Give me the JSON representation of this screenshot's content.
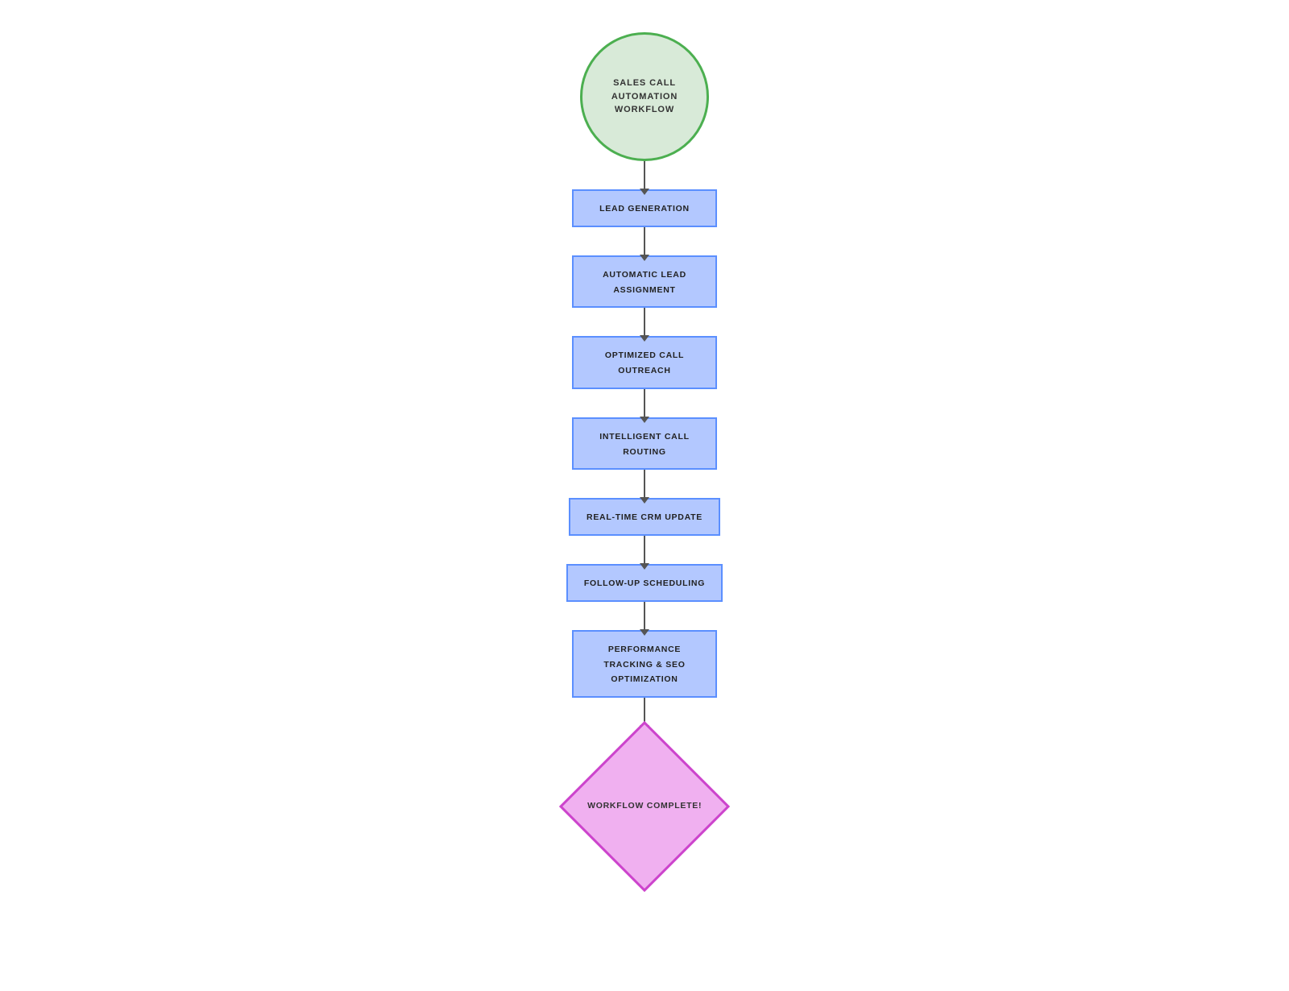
{
  "flowchart": {
    "title": "SALES CALL\nAUTOMATION WORKFLOW",
    "steps": [
      {
        "id": "lead-generation",
        "label": "LEAD GENERATION"
      },
      {
        "id": "automatic-lead-assignment",
        "label": "AUTOMATIC LEAD\nASSIGNMENT"
      },
      {
        "id": "optimized-call-outreach",
        "label": "OPTIMIZED CALL\nOUTREACH"
      },
      {
        "id": "intelligent-call-routing",
        "label": "INTELLIGENT CALL\nROUTING"
      },
      {
        "id": "real-time-crm-update",
        "label": "REAL-TIME CRM UPDATE"
      },
      {
        "id": "follow-up-scheduling",
        "label": "FOLLOW-UP SCHEDULING"
      },
      {
        "id": "performance-tracking",
        "label": "PERFORMANCE\nTRACKING & SEO\nOPTIMIZATION"
      }
    ],
    "end_label": "WORKFLOW COMPLETE!"
  }
}
